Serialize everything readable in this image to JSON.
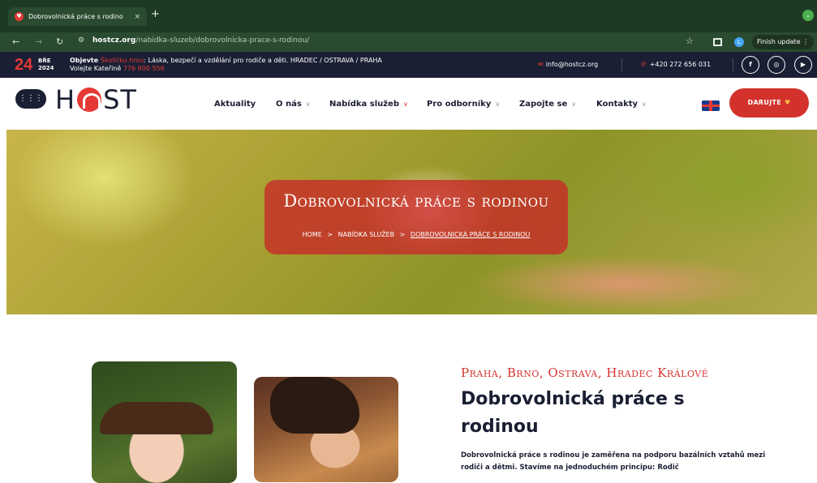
{
  "browser": {
    "tab_title": "Dobrovolnická práce s rodino",
    "tab_close": "×",
    "new_tab": "+",
    "url_host": "hostcz.org",
    "url_path": "/nabidka-sluzeb/dobrovolnicka-prace-s-rodinou/",
    "profile_initial": "L",
    "finish_update": "Finish update",
    "menu_dots": "⋮",
    "tab_menu_icon": "⌄"
  },
  "topbar": {
    "date_day": "24",
    "date_month": "BŘE",
    "date_year": "2024",
    "promo_line1_prefix": "Objevte ",
    "promo_line1_link": "Školičku hrou",
    "promo_line1_rest": ": Láska, bezpečí a vzdělání pro rodiče a děti. HRADEC / OSTRAVA / PRAHA",
    "promo_line2_prefix": "Volejte Kateřině ",
    "promo_line2_phone": "776 800 556",
    "email": "info@hostcz.org",
    "phone": "+420 272 656 031",
    "social": [
      "f",
      "◎",
      "▶"
    ]
  },
  "header": {
    "logo_text_left": "H",
    "logo_text_right": "ST",
    "menu": [
      {
        "label": "Aktuality"
      },
      {
        "label": "O nás"
      },
      {
        "label": "Nabídka služeb"
      },
      {
        "label": "Pro odborníky"
      },
      {
        "label": "Zapojte se"
      },
      {
        "label": "Kontakty"
      }
    ],
    "donate_label": "DARUJTE",
    "donate_heart": "♥",
    "colors": {
      "accent": "#d3322c",
      "navy": "#1a1f33"
    }
  },
  "hero": {
    "title": "Dobrovolnická práce s rodinou",
    "breadcrumb": [
      "HOME",
      "NABÍDKA SLUŽEB",
      "DOBROVOLNICKÁ PRÁCE S RODINOU"
    ],
    "separator": ">"
  },
  "content": {
    "subheading": "Praha, Brno, Ostrava, Hradec Králové",
    "heading": "Dobrovolnická práce s rodinou",
    "paragraph": "Dobrovolnická práce s rodinou je zaměřena na podporu bazálních vztahů mezi rodiči a dětmi. Stavíme na jednoduchém principu: Rodič"
  }
}
